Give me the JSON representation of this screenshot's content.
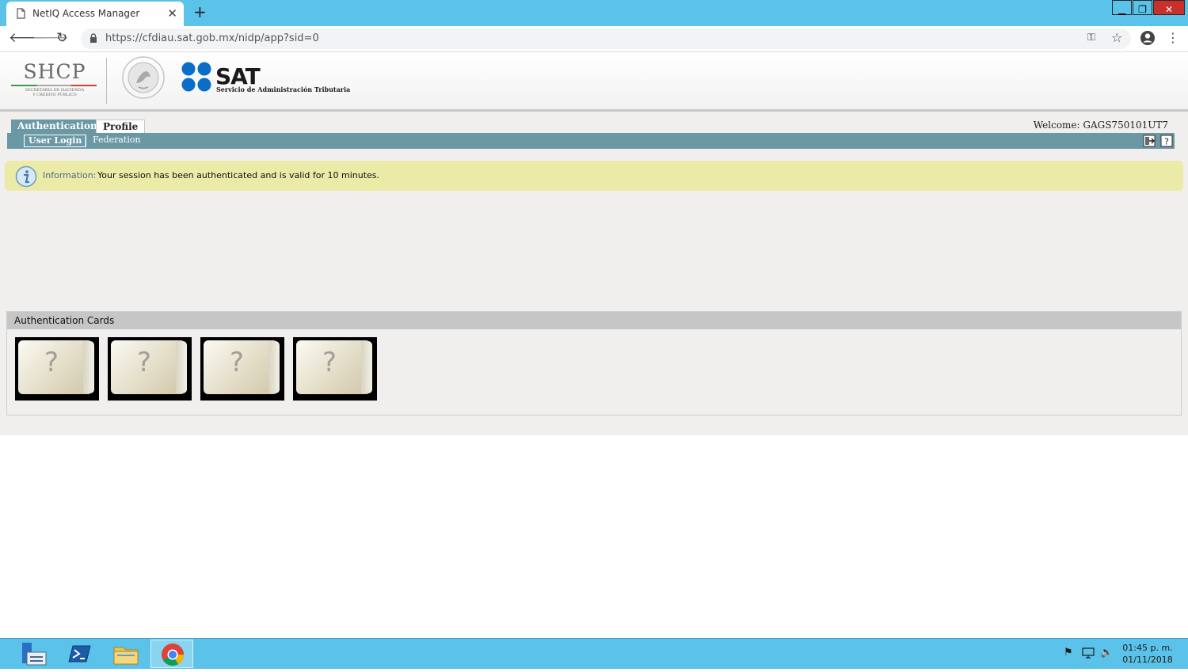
{
  "browser": {
    "tab_title": "NetIQ Access Manager",
    "tab_close": "✕",
    "new_tab": "+",
    "url": "https://cfdiau.sat.gob.mx/nidp/app?sid=0",
    "window_controls": {
      "minimize": "▁",
      "maximize": "❐",
      "close": "✕"
    }
  },
  "banner": {
    "shcp_title": "SHCP",
    "shcp_subtitle_1": "SECRETARÍA DE HACIENDA",
    "shcp_subtitle_2": "Y CRÉDITO PÚBLICO",
    "sat_title": "SAT",
    "sat_subtitle": "Servicio de Administración Tributaria"
  },
  "nav": {
    "tabs": [
      {
        "label": "Authentication",
        "active": true
      },
      {
        "label": "Profile",
        "active": false
      }
    ],
    "welcome": "Welcome: GAGS750101UT7",
    "subnav": [
      {
        "label": "User Login",
        "active": true
      },
      {
        "label": "Federation",
        "active": false
      }
    ],
    "separator": "|"
  },
  "info": {
    "label": "Information:",
    "message": "Your session has been authenticated and is valid for 10 minutes."
  },
  "cards": {
    "header": "Authentication Cards",
    "items": [
      {
        "symbol": "?"
      },
      {
        "symbol": "?"
      },
      {
        "symbol": "?"
      },
      {
        "symbol": "?"
      }
    ]
  },
  "taskbar": {
    "apps": [
      "server-manager-icon",
      "powershell-icon",
      "file-explorer-icon",
      "chrome-icon"
    ],
    "time": "01:45 p. m.",
    "date": "01/11/2018"
  },
  "colors": {
    "titlebar": "#5bc3e9",
    "nav_bar": "#6a98a4",
    "info_bg": "#ebeaa6",
    "sat_blue": "#0a6ec8"
  }
}
